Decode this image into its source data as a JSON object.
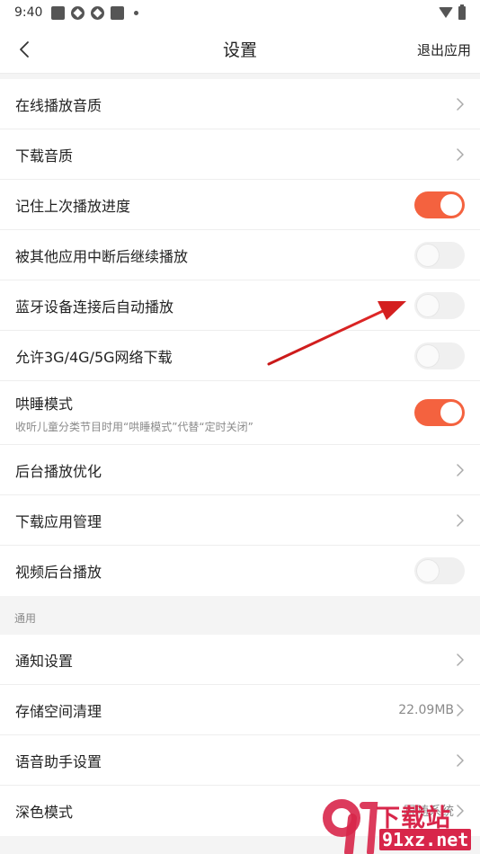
{
  "status_bar": {
    "time": "9:40"
  },
  "nav": {
    "title": "设置",
    "exit_label": "退出应用"
  },
  "playback_items": [
    {
      "label": "在线播放音质",
      "control": "chevron"
    },
    {
      "label": "下载音质",
      "control": "chevron"
    },
    {
      "label": "记住上次播放进度",
      "control": "toggle",
      "on": true
    },
    {
      "label": "被其他应用中断后继续播放",
      "control": "toggle",
      "on": false
    },
    {
      "label": "蓝牙设备连接后自动播放",
      "control": "toggle",
      "on": false
    },
    {
      "label": "允许3G/4G/5G网络下载",
      "control": "toggle",
      "on": false
    },
    {
      "label": "哄睡模式",
      "sublabel": "收听儿童分类节目时用“哄睡模式”代替“定时关闭”",
      "control": "toggle",
      "on": true
    },
    {
      "label": "后台播放优化",
      "control": "chevron"
    },
    {
      "label": "下载应用管理",
      "control": "chevron"
    },
    {
      "label": "视频后台播放",
      "control": "toggle",
      "on": false
    }
  ],
  "general": {
    "header": "通用",
    "items": [
      {
        "label": "通知设置",
        "control": "chevron"
      },
      {
        "label": "存储空间清理",
        "value": "22.09MB",
        "control": "chevron"
      },
      {
        "label": "语音助手设置",
        "control": "chevron"
      },
      {
        "label": "深色模式",
        "value": "跟随系统",
        "control": "chevron"
      }
    ]
  },
  "watermark": {
    "title": "下载站",
    "url": "91xz.net"
  },
  "colors": {
    "accent": "#f4623f",
    "annotation_arrow": "#d42020",
    "watermark": "#d8264a"
  }
}
